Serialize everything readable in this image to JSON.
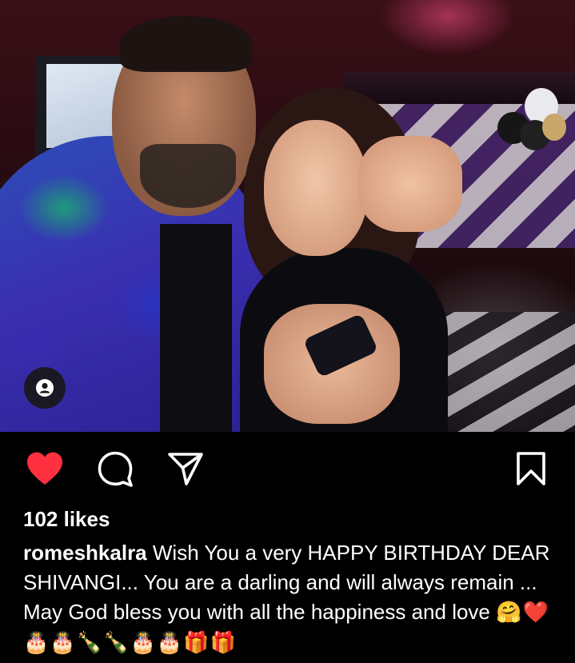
{
  "post": {
    "photo": {
      "alt_icon": "user-tag-icon"
    },
    "actions": {
      "like_icon": "heart-filled-icon",
      "like_color": "#ff3040",
      "comment_icon": "comment-icon",
      "share_icon": "paper-plane-icon",
      "save_icon": "bookmark-icon"
    },
    "likes": "102 likes",
    "caption": {
      "username": "romeshkalra",
      "text": " Wish You a very HAPPY BIRTHDAY DEAR SHIVANGI... You are a darling and will always remain ... May God bless you with all the happiness and love ",
      "emojis": "🤗❤️🎂🎂🍾🍾🎂🎂🎁🎁"
    }
  }
}
